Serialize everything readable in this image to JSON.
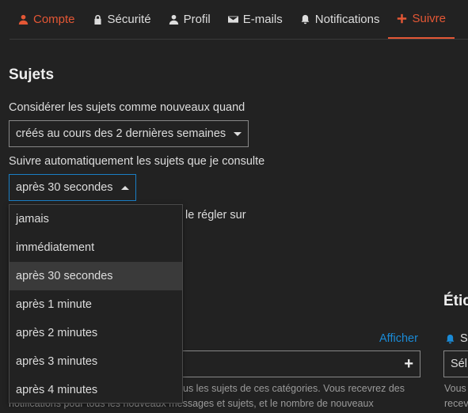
{
  "tabs": [
    {
      "label": "Compte",
      "icon": "user-icon"
    },
    {
      "label": "Sécurité",
      "icon": "lock-icon"
    },
    {
      "label": "Profil",
      "icon": "user-icon"
    },
    {
      "label": "E-mails",
      "icon": "envelope-icon"
    },
    {
      "label": "Notifications",
      "icon": "bell-icon"
    },
    {
      "label": "Suivre",
      "icon": "plus-icon"
    }
  ],
  "colors": {
    "accent": "#e45735",
    "link": "#1a8ad6",
    "focus": "#1a7ec4",
    "background": "#222222"
  },
  "topics": {
    "title": "Sujets",
    "new_topics_label": "Considérer les sujets comme nouveaux quand",
    "new_topics_value": "créés au cours des 2 dernières semaines",
    "auto_track_label": "Suivre automatiquement les sujets que je consulte",
    "auto_track_value": "après 30 secondes",
    "auto_track_options": [
      "jamais",
      "immédiatement",
      "après 30 secondes",
      "après 1 minute",
      "après 2 minutes",
      "après 3 minutes",
      "après 4 minutes"
    ],
    "behind_text": "le régler sur"
  },
  "categories": {
    "show_link": "Afficher",
    "help_line1": "us les sujets de ces catégories. Vous recevrez des",
    "help_line2": "notifications pour tous les nouveaux messages et sujets, et le nombre de nouveaux"
  },
  "tags": {
    "title": "Étic",
    "bell_label": "S",
    "select_value": "Sél",
    "help_line1": "Vous",
    "help_line2": "recev"
  }
}
